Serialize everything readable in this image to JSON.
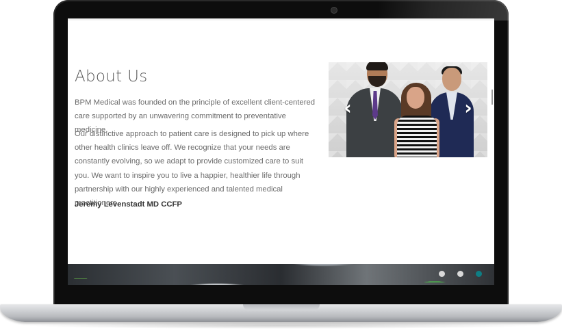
{
  "about": {
    "heading": "About Us",
    "paragraph1": "BPM Medical was founded on the principle of excellent client-centered care supported by an unwavering commitment to preventative medicine.",
    "paragraph2": "Our distinctive approach to patient care is designed to pick up where other health clinics leave off. We recognize that your needs are constantly evolving, so we adapt to provide customized care to suit you. We want to inspire you to live a happier, healthier life through partnership with our highly experienced and talented medical practitioners.",
    "signature": "Jeremy Levenstadt MD CCFP"
  },
  "slider": {
    "prev_icon": "chevron-left-icon",
    "next_icon": "chevron-right-icon",
    "prev_glyph": "‹",
    "next_glyph": "›"
  },
  "banner": {
    "dots": [
      {
        "state": "inactive",
        "color": "#d9d9d9"
      },
      {
        "state": "inactive",
        "color": "#d9d9d9"
      },
      {
        "state": "active",
        "color": "#0e7e84"
      }
    ]
  },
  "colors": {
    "text": "#6b6b6b",
    "heading": "#5a5a5a",
    "accent_dot": "#0e7e84"
  }
}
